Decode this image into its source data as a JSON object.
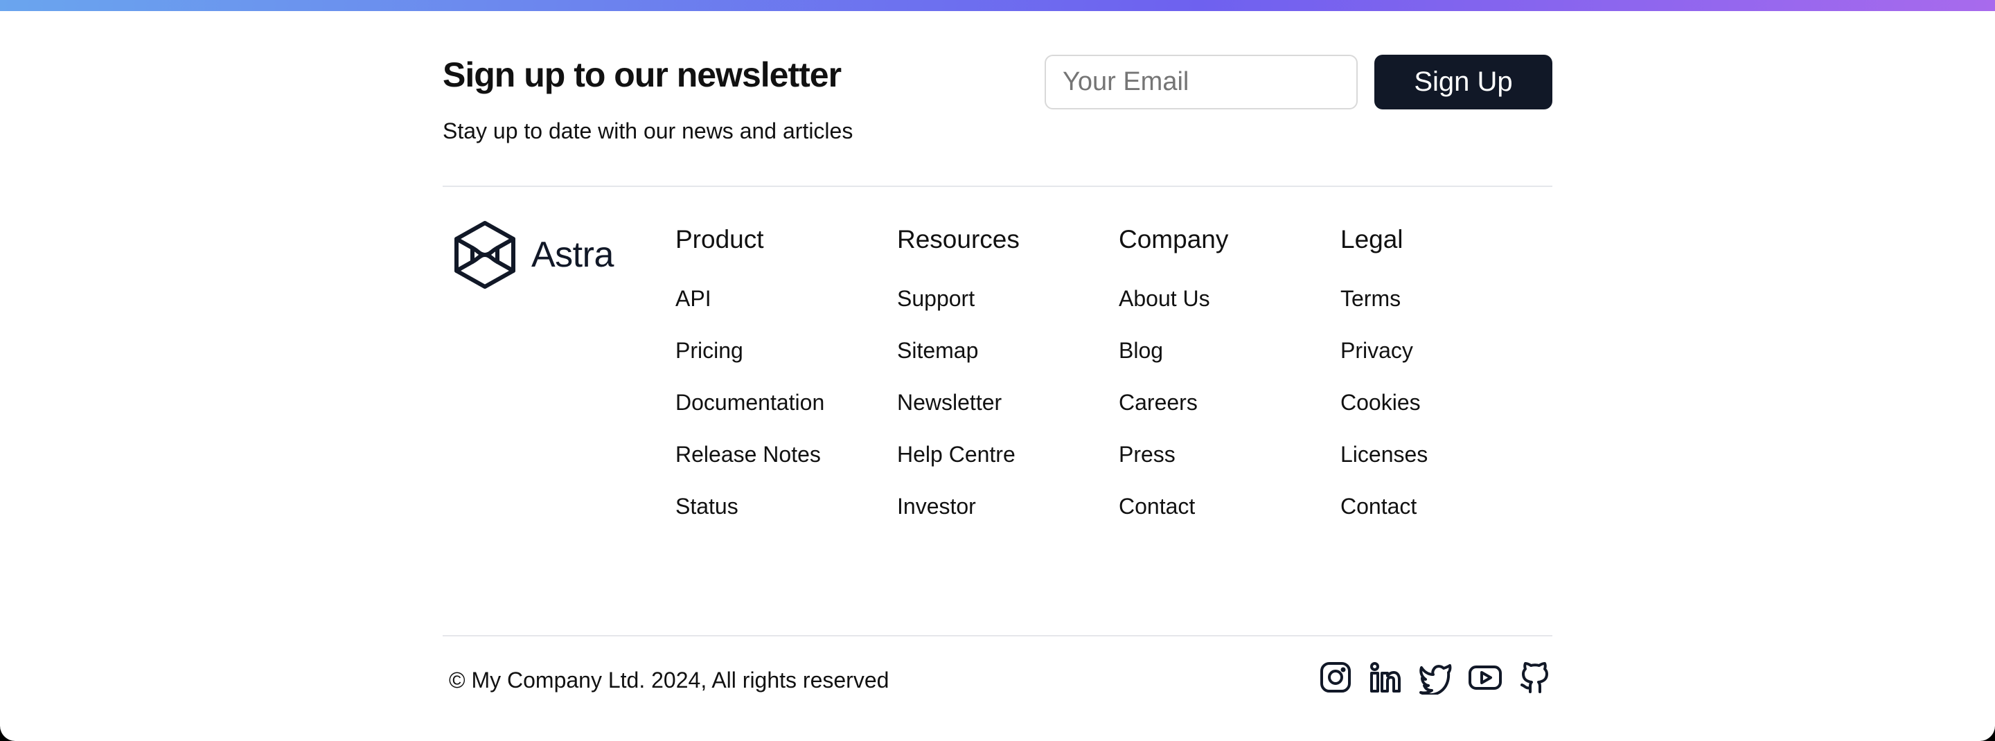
{
  "colors": {
    "gradient_start": "#6aa5ee",
    "gradient_mid": "#6e61ef",
    "gradient_end": "#a86aed",
    "button_bg": "#111827",
    "text": "#111111"
  },
  "newsletter": {
    "title": "Sign up to our newsletter",
    "subtitle": "Stay up to date with our news and articles",
    "email_placeholder": "Your Email",
    "email_value": "",
    "signup_label": "Sign Up"
  },
  "brand": {
    "name": "Astra",
    "logo_icon": "hexagon-logo-icon"
  },
  "columns": [
    {
      "title": "Product",
      "links": [
        "API",
        "Pricing",
        "Documentation",
        "Release Notes",
        "Status"
      ]
    },
    {
      "title": "Resources",
      "links": [
        "Support",
        "Sitemap",
        "Newsletter",
        "Help Centre",
        "Investor"
      ]
    },
    {
      "title": "Company",
      "links": [
        "About Us",
        "Blog",
        "Careers",
        "Press",
        "Contact"
      ]
    },
    {
      "title": "Legal",
      "links": [
        "Terms",
        "Privacy",
        "Cookies",
        "Licenses",
        "Contact"
      ]
    }
  ],
  "footer": {
    "copyright": "© My Company Ltd. 2024, All rights reserved",
    "socials": [
      "instagram-icon",
      "linkedin-icon",
      "twitter-icon",
      "youtube-icon",
      "github-icon"
    ]
  }
}
